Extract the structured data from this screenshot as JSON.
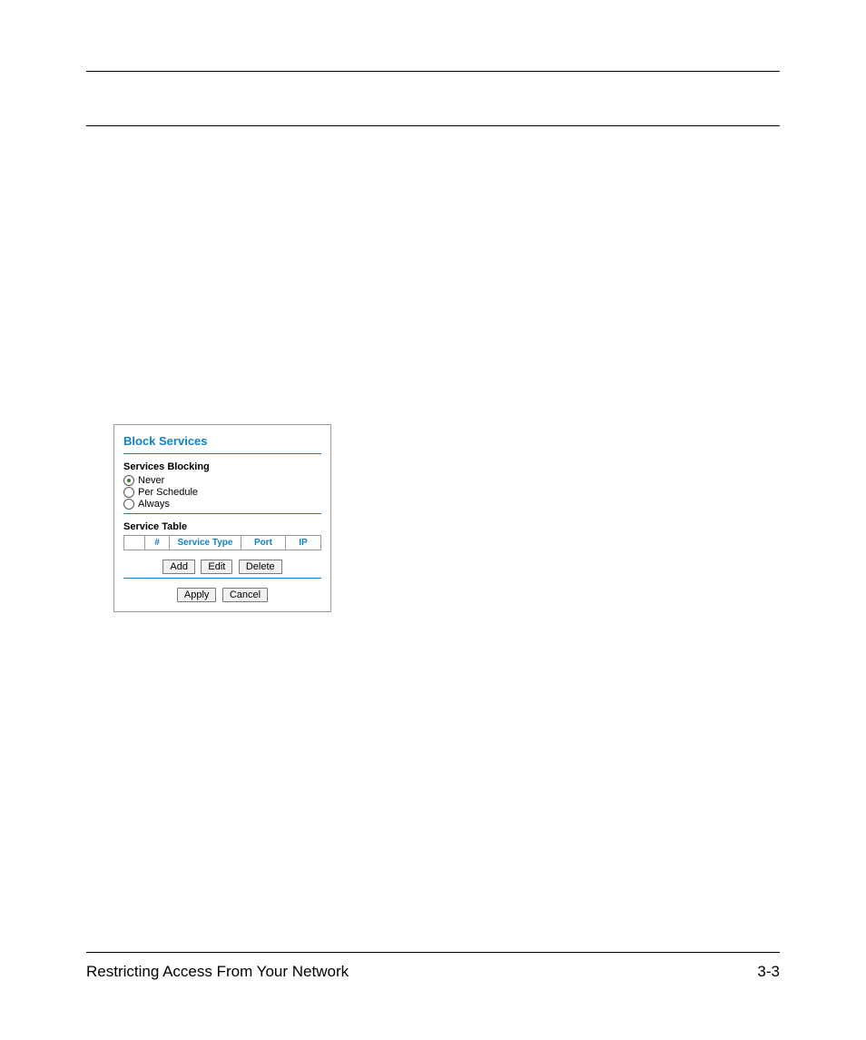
{
  "panel": {
    "title": "Block Services",
    "services_blocking_label": "Services Blocking",
    "radios": {
      "never": "Never",
      "per_schedule": "Per Schedule",
      "always": "Always",
      "selected": "never"
    },
    "service_table_label": "Service Table",
    "table_headers": {
      "num": "#",
      "service_type": "Service Type",
      "port": "Port",
      "ip": "IP"
    },
    "buttons": {
      "add": "Add",
      "edit": "Edit",
      "delete": "Delete",
      "apply": "Apply",
      "cancel": "Cancel"
    }
  },
  "footer": {
    "left": "Restricting Access From Your Network",
    "right": "3-3"
  }
}
